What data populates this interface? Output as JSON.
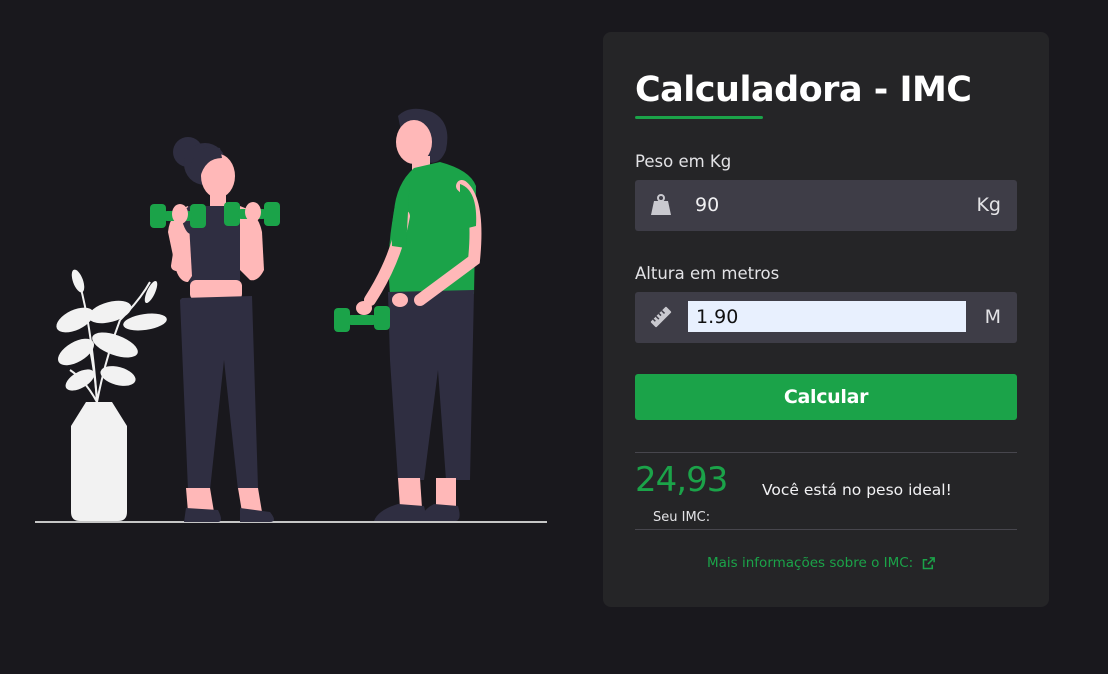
{
  "calculator": {
    "title": "Calculadora - IMC",
    "weight": {
      "label": "Peso em Kg",
      "value": "90",
      "unit": "Kg",
      "icon": "weight-icon"
    },
    "height": {
      "label": "Altura em metros",
      "value": "1.90",
      "unit": "M",
      "icon": "ruler-icon"
    },
    "submit_label": "Calcular"
  },
  "result": {
    "imc_value": "24,93",
    "imc_label": "Seu IMC:",
    "status": "Você está no peso ideal!"
  },
  "more_info": {
    "label": "Mais informações sobre o IMC:",
    "icon": "external-link-icon"
  },
  "colors": {
    "background": "#19181d",
    "card": "#252527",
    "accent": "#1ba349",
    "input": "#3e3d47"
  }
}
